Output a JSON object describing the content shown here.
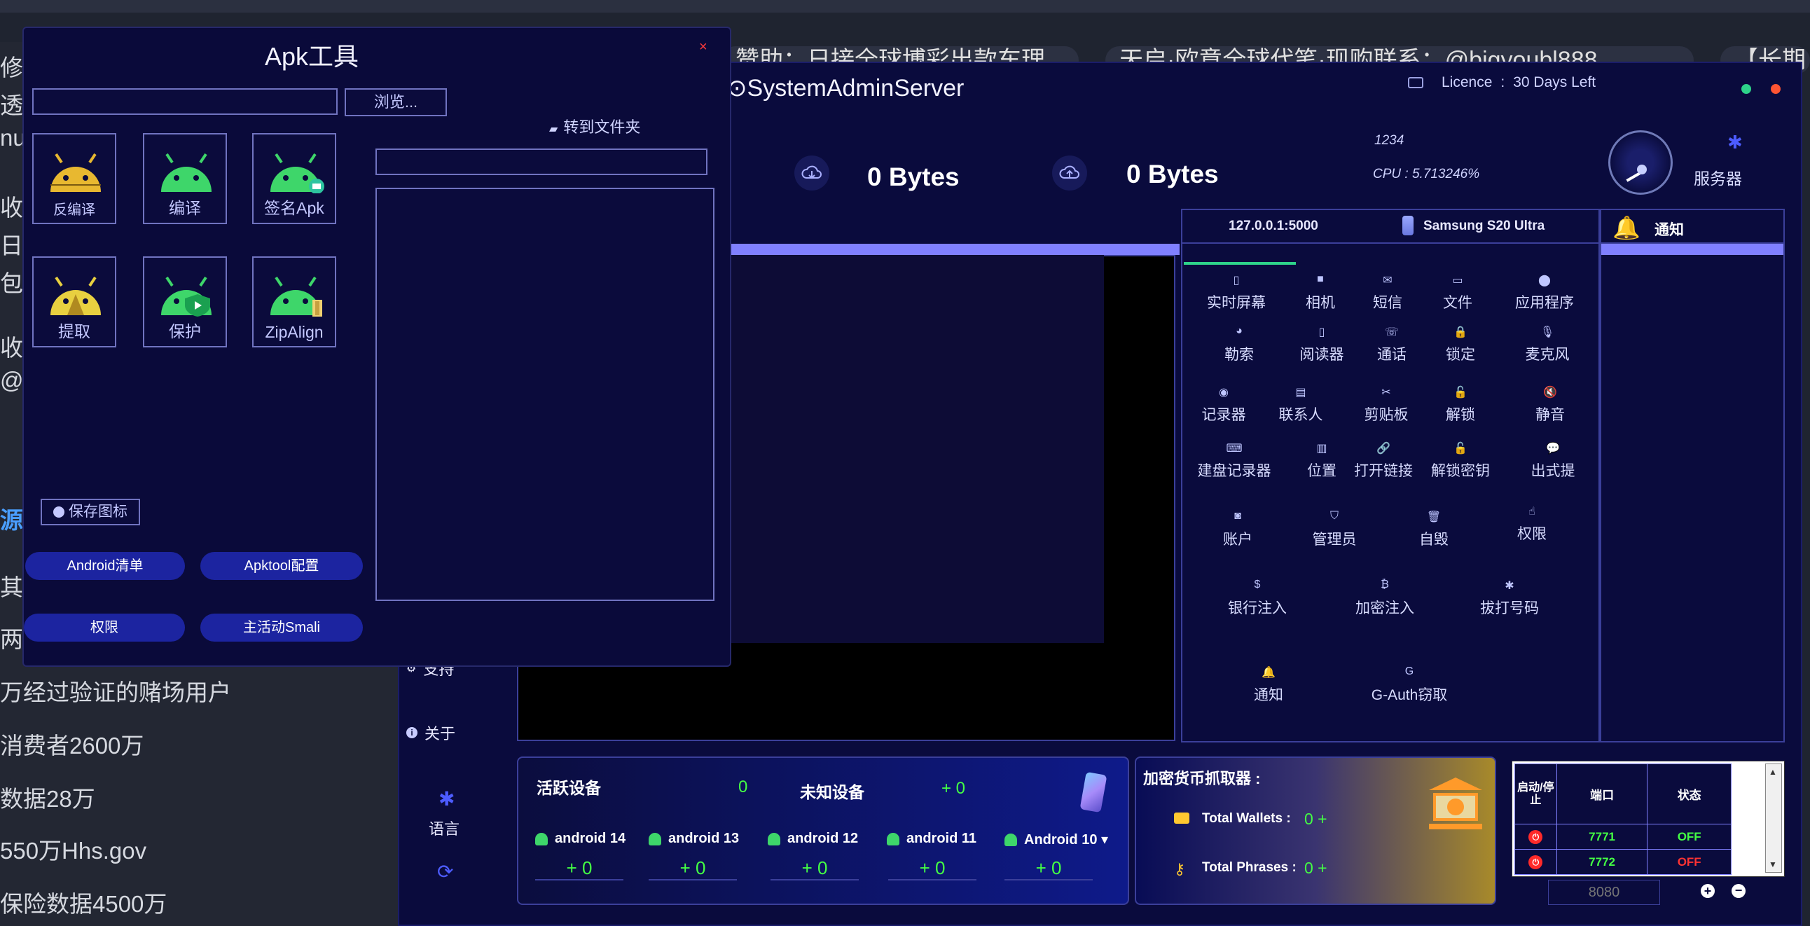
{
  "background": {
    "tabs": [
      "赞助：日接全球博彩出款车理",
      "天启·欧意全球代笔·现购联系：@bigyoubl888",
      "【长期"
    ],
    "left_lines": [
      "修进",
      "透探",
      "nuj",
      "收网",
      "日消",
      "包养",
      "收数",
      "@",
      "源",
      "其",
      "两",
      "万经过验证的赌场用户",
      "消费者2600万",
      "数据28万",
      "550万Hhs.gov",
      "保险数据4500万"
    ]
  },
  "app": {
    "title": "⊙SystemAdminServer",
    "licence_label": "Licence",
    "licence_value": "30 Days Left",
    "download": "0 Bytes",
    "upload": "0 Bytes",
    "cpu_id": "1234",
    "cpu": "CPU : 5.713246%",
    "server_label": "服务器",
    "nav": {
      "support": "支持",
      "about": "关于",
      "language": "语言"
    }
  },
  "device": {
    "address": "127.0.0.1:5000",
    "model": "Samsung S20 Ultra",
    "notification_header": "通知"
  },
  "controls": [
    [
      "实时屏幕",
      "相机",
      "短信",
      "文件",
      "应用程序"
    ],
    [
      "勒索",
      "阅读器",
      "通话",
      "锁定",
      "麦克风"
    ],
    [
      "记录器",
      "联系人",
      "剪贴板",
      "解锁",
      "静音"
    ],
    [
      "建盘记录器",
      "位置",
      "打开链接",
      "解锁密钥",
      "出式提"
    ],
    [
      "账户",
      "管理员",
      "自毁",
      "权限"
    ],
    [
      "银行注入",
      "加密注入",
      "拔打号码"
    ],
    [
      "通知",
      "G-Auth窃取"
    ]
  ],
  "stats": {
    "active_label": "活跃设备",
    "active_value": "0",
    "unknown_label": "未知设备",
    "unknown_value": "+ 0",
    "versions": [
      {
        "name": "android 14",
        "count": "+ 0"
      },
      {
        "name": "android 13",
        "count": "+ 0"
      },
      {
        "name": "android 12",
        "count": "+ 0"
      },
      {
        "name": "android 11",
        "count": "+ 0"
      },
      {
        "name": "Android 10 ▾",
        "count": "+ 0"
      }
    ]
  },
  "crypto": {
    "title": "加密货币抓取器 :",
    "wallets_label": "Total Wallets :",
    "wallets_value": "0 +",
    "phrases_label": "Total Phrases :",
    "phrases_value": "0 +"
  },
  "ports": {
    "headers": [
      "启动/停止",
      "端口",
      "状态"
    ],
    "rows": [
      {
        "port": "7771",
        "status": "OFF"
      },
      {
        "port": "7772",
        "status": "OFF"
      }
    ],
    "input_placeholder": "8080"
  },
  "apk": {
    "title": "Apk工具",
    "close": "×",
    "browse": "浏览...",
    "goto_folder": "转到文件夹",
    "tools": [
      "反编译",
      "编译",
      "签名Apk",
      "提取",
      "保护",
      "ZipAlign"
    ],
    "save_icon": "保存图标",
    "buttons": [
      "Android清单",
      "Apktool配置",
      "权限",
      "主活动Smali"
    ]
  },
  "colors": {
    "accent": "#8080ff",
    "panel": "#0a0b3d",
    "green": "#44ff44",
    "red": "#ff3333"
  }
}
